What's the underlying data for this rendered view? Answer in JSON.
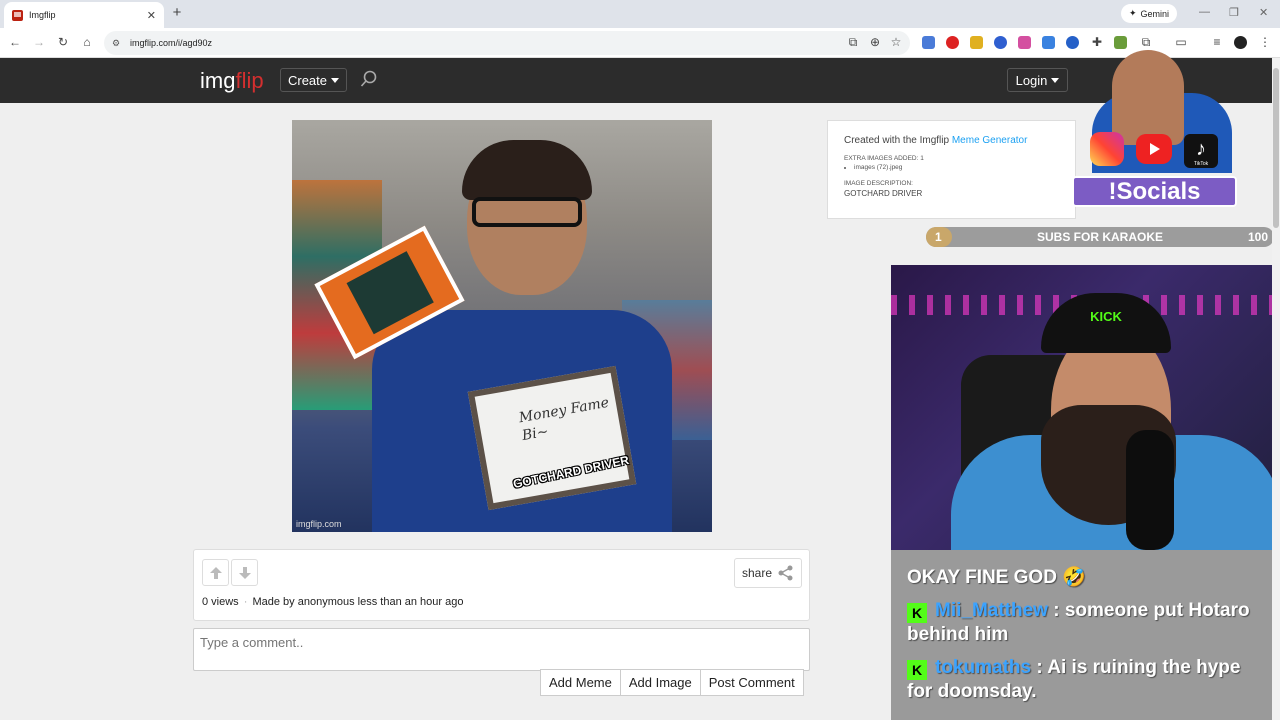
{
  "browser": {
    "tab_title": "Imgflip",
    "url": "imgflip.com/i/agd90z",
    "gemini_label": "Gemini",
    "new_tab_glyph": "+",
    "tab_close_glyph": "✕"
  },
  "site_header": {
    "logo_main": "img",
    "logo_accent": "flip",
    "create_label": "Create",
    "login_label": "Login"
  },
  "meme": {
    "sign_text": "Money Fame Bi~",
    "caption": "GOTCHARD DRIVER",
    "watermark": "imgflip.com"
  },
  "info_panel": {
    "share_label": "share",
    "views": "0 views",
    "made_by": "Made by anonymous less than an hour ago"
  },
  "comment": {
    "placeholder": "Type a comment..",
    "add_meme": "Add Meme",
    "add_image": "Add Image",
    "post_comment": "Post Comment"
  },
  "info_card": {
    "created_prefix": "Created with the Imgflip",
    "generator_link": "Meme Generator",
    "extra_label": "EXTRA IMAGES ADDED: 1",
    "extra_item": "images (72).jpeg",
    "desc_label": "IMAGE DESCRIPTION:",
    "desc": "GOTCHARD DRIVER"
  },
  "overlay": {
    "socials_label": "!Socials",
    "tiktok_text": "TikTok",
    "subs_title": "SUBS FOR KARAOKE",
    "subs_current": "1",
    "subs_goal": "100",
    "subs_progress": 0.01,
    "cap_text": "KICK",
    "chat": [
      {
        "user": "",
        "text": "OKAY FINE GOD 🤣"
      },
      {
        "user": "Mii_Matthew",
        "text": " : someone put Hotaro behind him"
      },
      {
        "user": "tokumaths",
        "text": " : Ai is ruining the hype for doomsday."
      }
    ]
  },
  "colors": {
    "header_bg": "#2c2c2c",
    "accent_red": "#d32f2f",
    "link_blue": "#1da1f2",
    "kick_green": "#53fc18"
  }
}
